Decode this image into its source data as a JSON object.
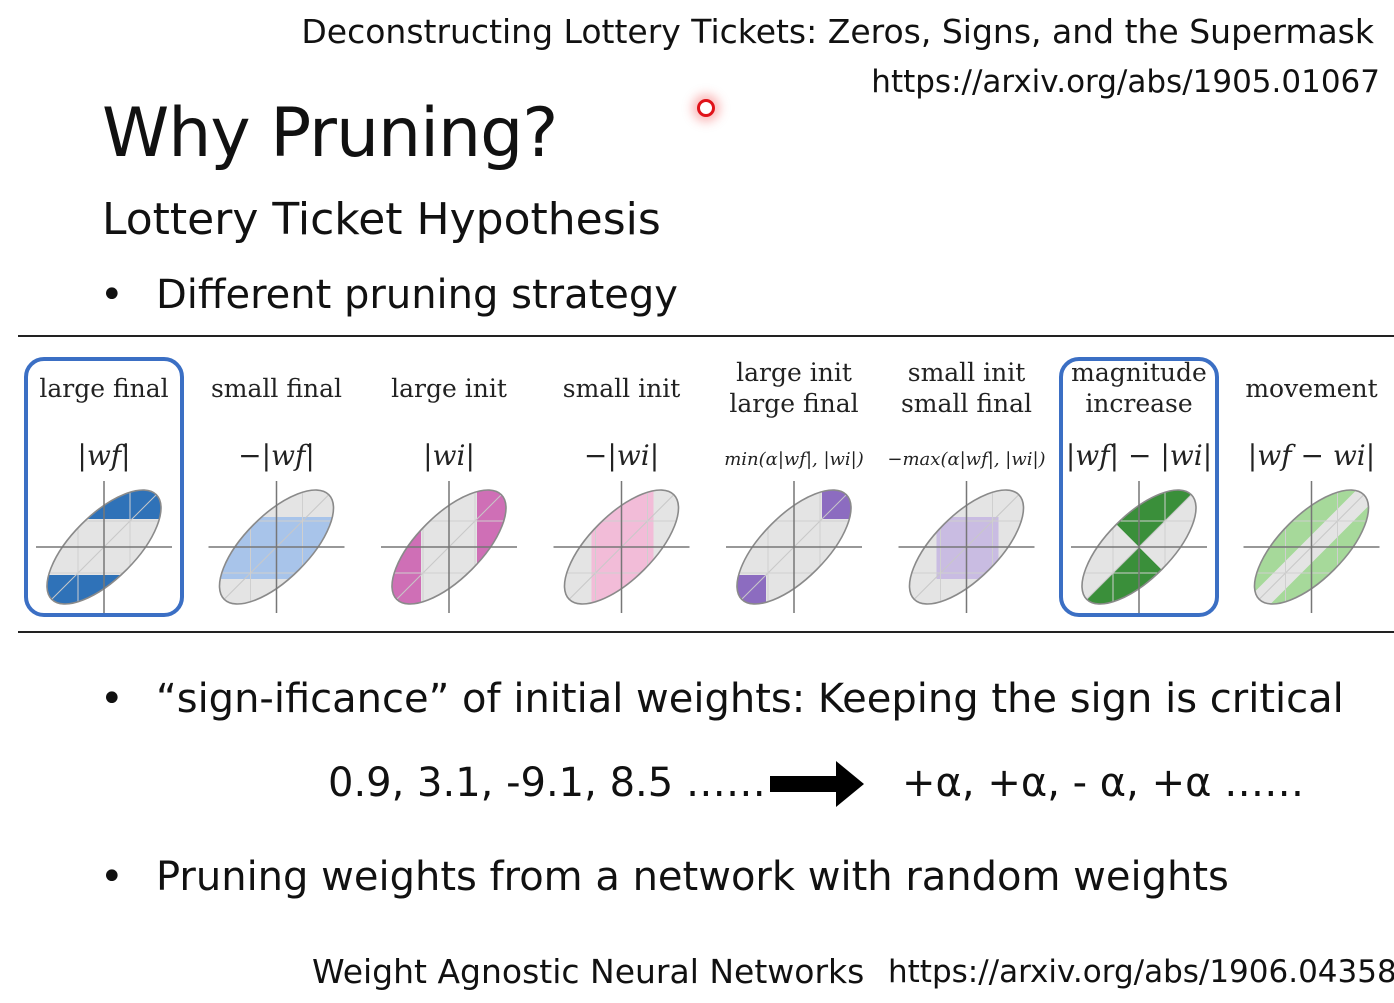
{
  "references": {
    "top_title": "Deconstructing Lottery Tickets: Zeros, Signs, and the Supermask",
    "top_url": "https://arxiv.org/abs/1905.01067",
    "bottom_title": "Weight Agnostic Neural Networks",
    "bottom_url": "https://arxiv.org/abs/1906.04358"
  },
  "slide": {
    "title": "Why Pruning?",
    "subtitle": "Lottery Ticket Hypothesis",
    "bullets": [
      "Different pruning strategy",
      "“sign-ificance” of initial weights: Keeping the sign is critical",
      "Pruning weights from a network with random weights"
    ],
    "bullet_symbol": "•"
  },
  "formula": {
    "values": "0.9, 3.1, -9.1, 8.5 ……",
    "signs": "+α, +α, - α, +α ……"
  },
  "strategies": [
    {
      "label_lines": [
        "large final"
      ],
      "formula": "|w_f|",
      "color": "#2f72b8",
      "highlighted": true,
      "icon": "ellipse-large-final-diagram"
    },
    {
      "label_lines": [
        "small final"
      ],
      "formula": "−|w_f|",
      "color": "#a8c4ea",
      "highlighted": false,
      "icon": "ellipse-small-final-diagram"
    },
    {
      "label_lines": [
        "large init"
      ],
      "formula": "|w_i|",
      "color": "#cf6fb6",
      "highlighted": false,
      "icon": "ellipse-large-init-diagram"
    },
    {
      "label_lines": [
        "small init"
      ],
      "formula": "−|w_i|",
      "color": "#f2bcd8",
      "highlighted": false,
      "icon": "ellipse-small-init-diagram"
    },
    {
      "label_lines": [
        "large init",
        "large final"
      ],
      "formula": "min(α|w_f|, |w_i|)",
      "color": "#8c6cc0",
      "highlighted": false,
      "icon": "ellipse-large-init-large-final-diagram"
    },
    {
      "label_lines": [
        "small init",
        "small final"
      ],
      "formula": "−max(α|w_f|, |w_i|)",
      "color": "#c9bce2",
      "highlighted": false,
      "icon": "ellipse-small-init-small-final-diagram"
    },
    {
      "label_lines": [
        "magnitude",
        "increase"
      ],
      "formula": "|w_f| − |w_i|",
      "color": "#3a8f3a",
      "highlighted": true,
      "icon": "ellipse-magnitude-increase-diagram"
    },
    {
      "label_lines": [
        "movement"
      ],
      "formula": "|w_f − w_i|",
      "color": "#a6d99a",
      "highlighted": false,
      "icon": "ellipse-movement-diagram"
    }
  ],
  "colors": {
    "highlight_border": "#3b6fc4",
    "ellipse_fill": "#e4e4e4",
    "ellipse_stroke": "#8a8a8a"
  }
}
